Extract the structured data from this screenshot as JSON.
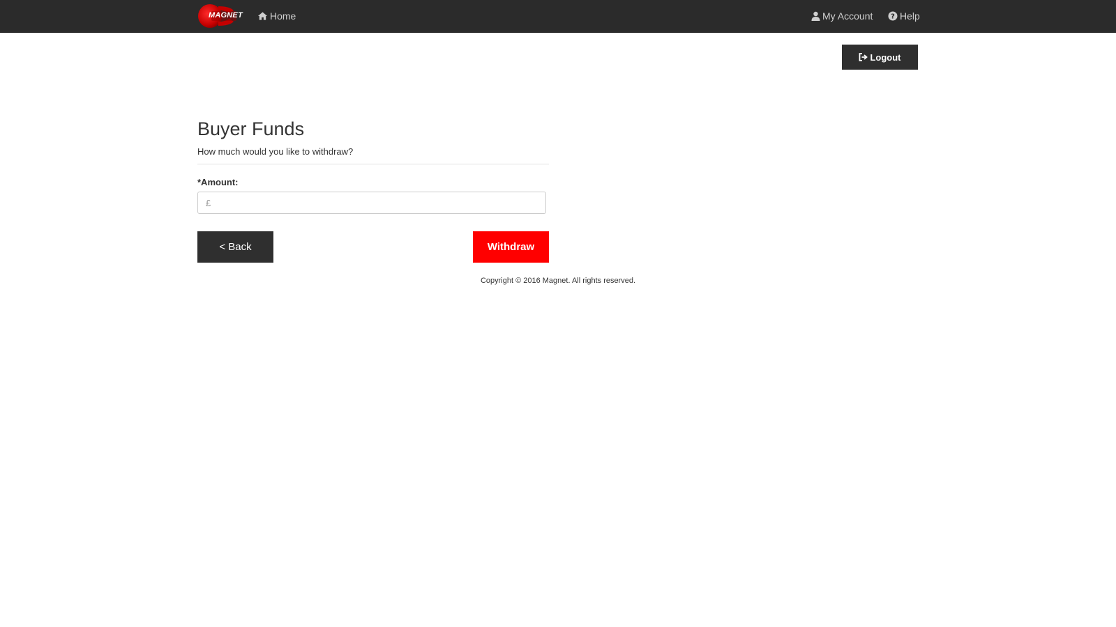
{
  "navbar": {
    "logo_text": "MAGNET",
    "home_label": "Home",
    "my_account_label": "My Account",
    "help_label": "Help",
    "icons": {
      "home": "home-icon",
      "account": "user-icon",
      "help": "question-circle-icon"
    },
    "background_color": "#2b2b2b",
    "logo_color": "#e00000"
  },
  "header": {
    "logout_label": "Logout",
    "logout_icon": "logout-icon"
  },
  "main": {
    "title": "Buyer Funds",
    "subtitle": "How much would you like to withdraw?",
    "amount_label": "*Amount:",
    "amount_value": "",
    "amount_placeholder": "£",
    "back_label": "< Back",
    "withdraw_label": "Withdraw",
    "withdraw_color": "#ff0000",
    "back_color": "#2f2f2f"
  },
  "footer": {
    "copyright": "Copyright © 2016 Magnet. All rights reserved."
  }
}
